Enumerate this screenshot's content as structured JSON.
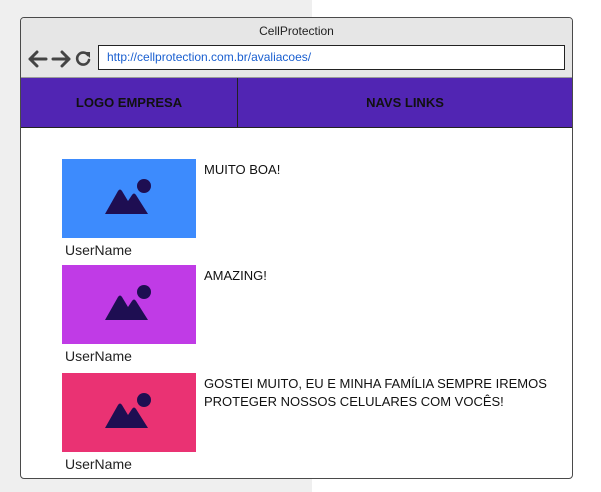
{
  "window": {
    "title": "CellProtection",
    "url": "http://cellprotection.com.br/avaliacoes/"
  },
  "header": {
    "logo_label": "LOGO EMPRESA",
    "nav_label": "NAVS LINKS"
  },
  "reviews": [
    {
      "text": "MUITO BOA!",
      "username": "UserName",
      "color": "#3d8bfd"
    },
    {
      "text": "AMAZING!",
      "username": "UserName",
      "color": "#c03be6"
    },
    {
      "text": "GOSTEI MUITO, EU E MINHA FAMÍLIA SEMPRE IREMOS PROTEGER NOSSOS CELULARES COM VOCÊS!",
      "username": "UserName",
      "color": "#ea3273"
    }
  ],
  "colors": {
    "header_bg": "#5125b3",
    "icon_color": "#1e0e52"
  },
  "icons": [
    "back-arrow-icon",
    "forward-arrow-icon",
    "reload-icon",
    "image-placeholder-icon"
  ]
}
